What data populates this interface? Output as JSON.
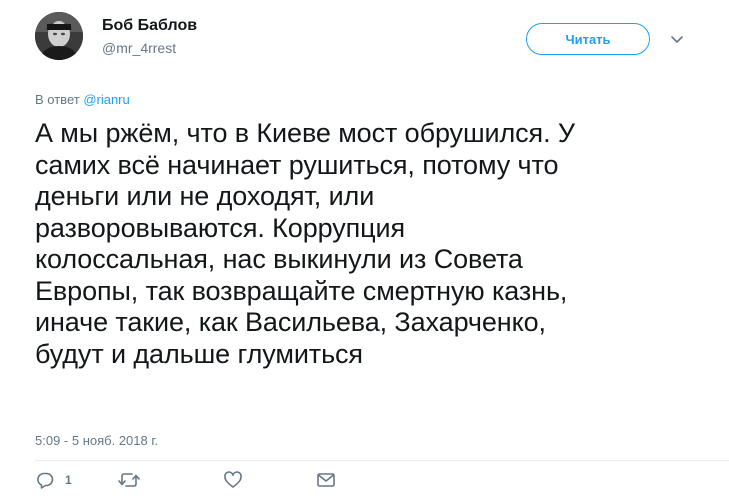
{
  "user": {
    "display_name": "Боб Баблов",
    "handle": "@mr_4rrest"
  },
  "header": {
    "follow_label": "Читать"
  },
  "reply": {
    "prefix": "В ответ ",
    "mention": "@rianru"
  },
  "tweet": {
    "lines": [
      "А мы ржём, что в Киеве мост обрушился. У",
      "самих всё начинает рушиться, потому что",
      "деньги или не доходят, или",
      "разворовываются. Коррупция",
      "колоссальная, нас выкинули из Совета",
      "Европы, так возвращайте смертную казнь,",
      "иначе такие, как Васильева, Захарченко,",
      "будут и дальше глумиться"
    ],
    "timestamp": "5:09 - 5 нояб. 2018 г."
  },
  "actions": {
    "reply_count": "1"
  },
  "colors": {
    "accent": "#1da1f2",
    "secondary_text": "#657786",
    "primary_text": "#14171a",
    "divider": "#e6ecf0"
  },
  "icons": {
    "reply": "speech-bubble-icon",
    "retweet": "retweet-arrows-icon",
    "like": "heart-icon",
    "dm": "envelope-icon",
    "caret": "chevron-down-icon"
  }
}
